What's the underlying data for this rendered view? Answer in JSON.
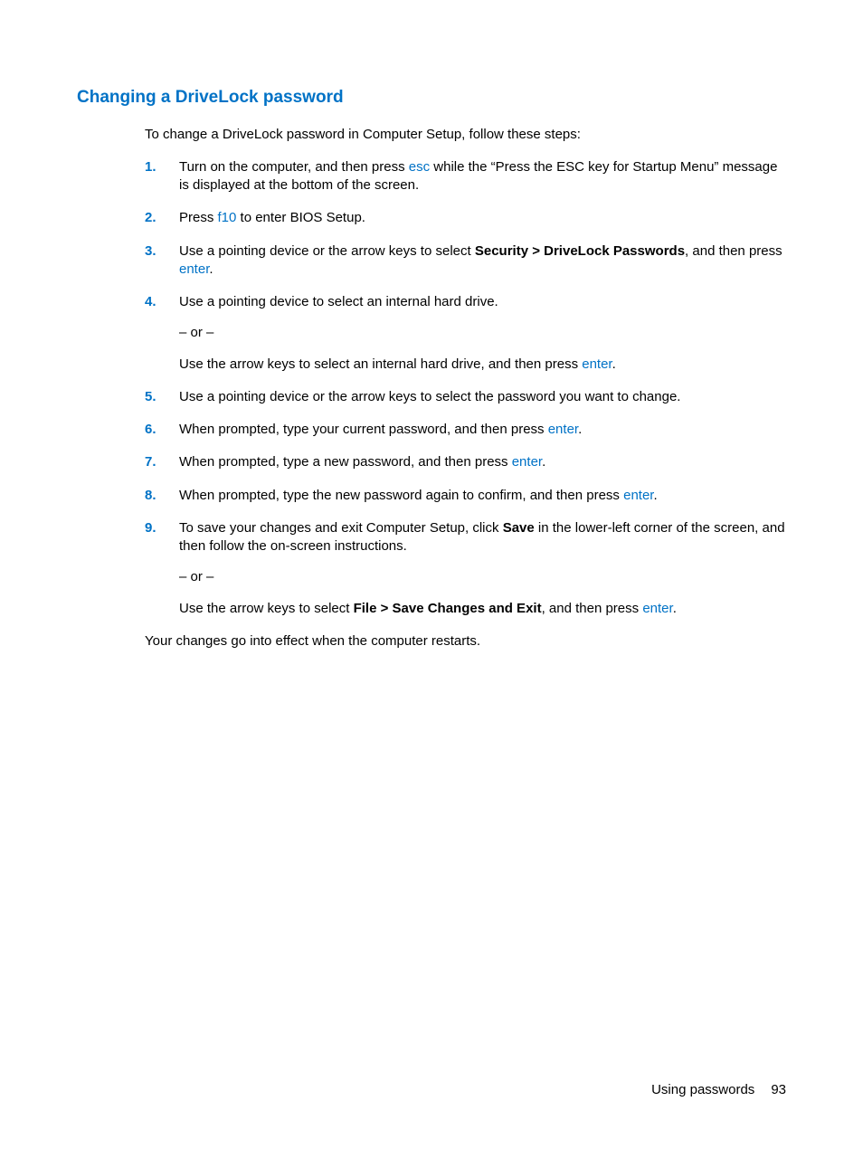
{
  "heading": "Changing a DriveLock password",
  "intro": "To change a DriveLock password in Computer Setup, follow these steps:",
  "closing": "Your changes go into effect when the computer restarts.",
  "steps": {
    "s1": {
      "num": "1.",
      "t1": "Turn on the computer, and then press ",
      "k1": "esc",
      "t2": " while the “Press the ESC key for Startup Menu” message is displayed at the bottom of the screen."
    },
    "s2": {
      "num": "2.",
      "t1": "Press ",
      "k1": "f10",
      "t2": " to enter BIOS Setup."
    },
    "s3": {
      "num": "3.",
      "t1": "Use a pointing device or the arrow keys to select ",
      "b1": "Security > DriveLock Passwords",
      "t2": ", and then press ",
      "k1": "enter",
      "t3": "."
    },
    "s4": {
      "num": "4.",
      "t1": "Use a pointing device to select an internal hard drive.",
      "or": "– or –",
      "t2": "Use the arrow keys to select an internal hard drive, and then press ",
      "k1": "enter",
      "t3": "."
    },
    "s5": {
      "num": "5.",
      "t1": "Use a pointing device or the arrow keys to select the password you want to change."
    },
    "s6": {
      "num": "6.",
      "t1": "When prompted, type your current password, and then press ",
      "k1": "enter",
      "t2": "."
    },
    "s7": {
      "num": "7.",
      "t1": "When prompted, type a new password, and then press ",
      "k1": "enter",
      "t2": "."
    },
    "s8": {
      "num": "8.",
      "t1": "When prompted, type the new password again to confirm, and then press ",
      "k1": "enter",
      "t2": "."
    },
    "s9": {
      "num": "9.",
      "t1": "To save your changes and exit Computer Setup, click ",
      "b1": "Save",
      "t2": " in the lower-left corner of the screen, and then follow the on-screen instructions.",
      "or": "– or –",
      "t3": "Use the arrow keys to select ",
      "b2": "File > Save Changes and Exit",
      "t4": ", and then press ",
      "k1": "enter",
      "t5": "."
    }
  },
  "footer": {
    "section": "Using passwords",
    "page": "93"
  }
}
